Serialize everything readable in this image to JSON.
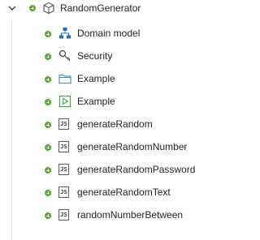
{
  "tree": {
    "root": {
      "label": "RandomGenerator",
      "expanded": true,
      "icon": "module-package-icon",
      "status_icon": "plus-circle-icon"
    },
    "items": [
      {
        "label": "Domain model",
        "icon": "domain-model-icon"
      },
      {
        "label": "Security",
        "icon": "key-icon"
      },
      {
        "label": "Example",
        "icon": "folder-icon"
      },
      {
        "label": "Example",
        "icon": "play-icon"
      },
      {
        "label": "generateRandom",
        "icon": "js-file-icon"
      },
      {
        "label": "generateRandomNumber",
        "icon": "js-file-icon"
      },
      {
        "label": "generateRandomPassword",
        "icon": "js-file-icon"
      },
      {
        "label": "generateRandomText",
        "icon": "js-file-icon"
      },
      {
        "label": "randomNumberBetween",
        "icon": "js-file-icon"
      }
    ],
    "js_badge": "JS"
  },
  "colors": {
    "status_green": "#5aa82b",
    "folder_blue": "#2b8fd6",
    "play_green": "#3daa3d",
    "domain_blue": "#1d70c4",
    "guide_line": "#e4e4e4"
  }
}
